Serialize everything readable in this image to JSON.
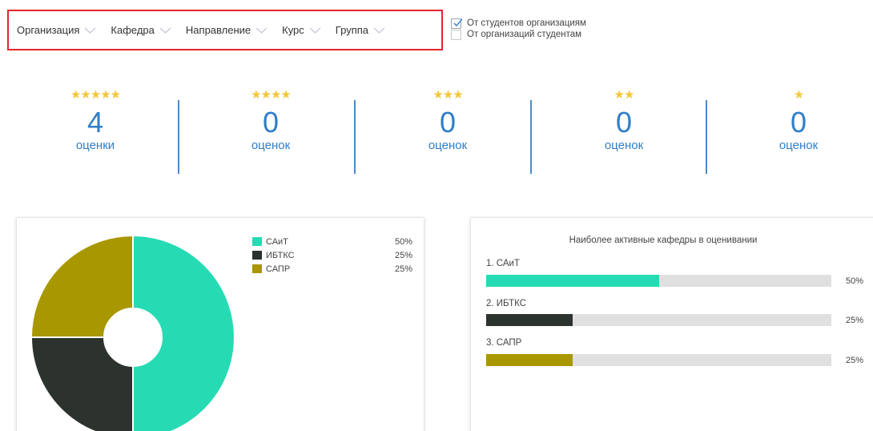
{
  "filters": {
    "items": [
      {
        "label": "Организация"
      },
      {
        "label": "Кафедра"
      },
      {
        "label": "Направление"
      },
      {
        "label": "Курс"
      },
      {
        "label": "Группа"
      }
    ]
  },
  "direction": {
    "options": [
      {
        "label": "От студентов организациям",
        "checked": true
      },
      {
        "label": "От организаций студентам",
        "checked": false
      }
    ]
  },
  "ratings": [
    {
      "stars": "★★★★★",
      "count": "4",
      "label": "оценки"
    },
    {
      "stars": "★★★★",
      "count": "0",
      "label": "оценок"
    },
    {
      "stars": "★★★",
      "count": "0",
      "label": "оценок"
    },
    {
      "stars": "★★",
      "count": "0",
      "label": "оценок"
    },
    {
      "stars": "★",
      "count": "0",
      "label": "оценок"
    }
  ],
  "colors": {
    "accent_blue": "#2f7ec9",
    "star_gold": "#f3c73b",
    "highlight_red": "#e8242f"
  },
  "chart_data": [
    {
      "type": "pie",
      "donut": true,
      "categories": [
        "САиТ",
        "ИБТКС",
        "САПР"
      ],
      "values": [
        50,
        25,
        25
      ],
      "value_labels": [
        "50%",
        "25%",
        "25%"
      ],
      "colors": [
        "#26dbb4",
        "#2c332e",
        "#a99700"
      ]
    },
    {
      "type": "bar",
      "orientation": "horizontal",
      "title": "Наиболее активные кафедры в оценивании",
      "categories": [
        "1. САиТ",
        "2. ИБТКС",
        "3. САПР"
      ],
      "values": [
        50,
        25,
        25
      ],
      "value_labels": [
        "50%",
        "25%",
        "25%"
      ],
      "xlim": [
        0,
        100
      ],
      "colors": [
        "#26dbb4",
        "#2c332e",
        "#a99700"
      ]
    }
  ]
}
